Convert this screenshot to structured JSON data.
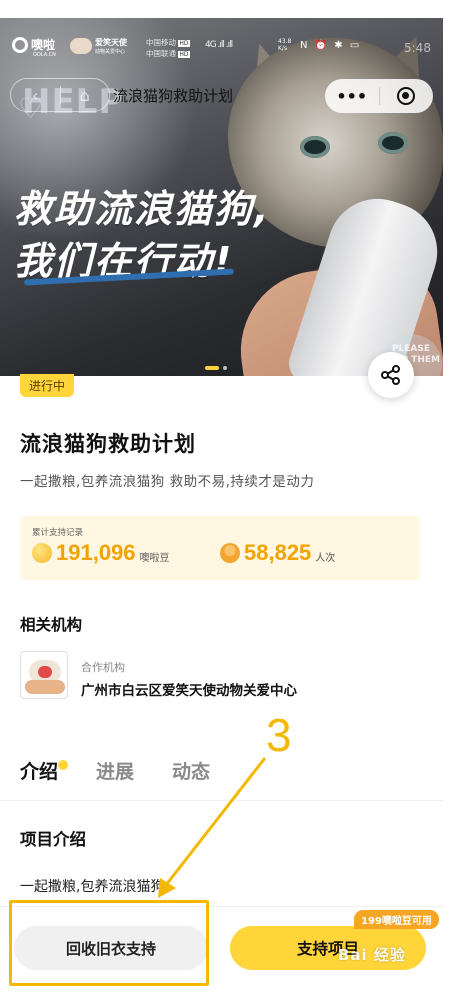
{
  "status_bar": {
    "brand_name": "噢啦",
    "brand_sub": "OOLA.CN",
    "partner_brand": "爱笑天使",
    "partner_sub": "动物关爱中心",
    "carrier1": "中国移动",
    "carrier2": "中国联通",
    "net_badge1": "HD",
    "net_badge2": "HD",
    "signal": "4G .ıll .ıll",
    "speed_value": "43.8",
    "speed_unit": "K/s",
    "sys_icons": "N ⏰ ✱ ▭",
    "clock": "5:48"
  },
  "nav": {
    "back_glyph": "‹",
    "home_glyph": "⌂",
    "title": "流浪猫狗救助计划",
    "more_glyph": "•••"
  },
  "hero": {
    "help_word": "HELP",
    "heart_glyph": "♡",
    "slogan_line1": "救助流浪猫狗,",
    "slogan_line2": "我们在行动!",
    "please_help": "PLEASE HELP THEM",
    "slides_total": 2,
    "slides_active": 1
  },
  "project": {
    "status": "进行中",
    "title": "流浪猫狗救助计划",
    "description": "一起撒粮,包养流浪猫狗 救助不易,持续才是动力",
    "stats_label": "累计支持记录",
    "beans_value": "191,096",
    "beans_unit": "噢啦豆",
    "people_value": "58,825",
    "people_unit": "人次"
  },
  "organization": {
    "heading": "相关机构",
    "role": "合作机构",
    "name": "广州市白云区爱笑天使动物关爱中心"
  },
  "tabs": [
    {
      "label": "介绍",
      "active": true
    },
    {
      "label": "进展",
      "active": false
    },
    {
      "label": "动态",
      "active": false
    }
  ],
  "intro": {
    "section_title": "项目介绍",
    "body": "一起撒粮,包养流浪猫狗"
  },
  "actions": {
    "recycle_label": "回收旧衣支持",
    "support_label": "支持项目",
    "coin_tag": "199噢啦豆可用"
  },
  "annotation": {
    "step_number": "3",
    "color": "#f5b800"
  },
  "watermark": "Bai 经验",
  "colors": {
    "accent_yellow": "#ffd53a",
    "stat_orange": "#f3a300",
    "card_bg": "#fff7e1"
  }
}
